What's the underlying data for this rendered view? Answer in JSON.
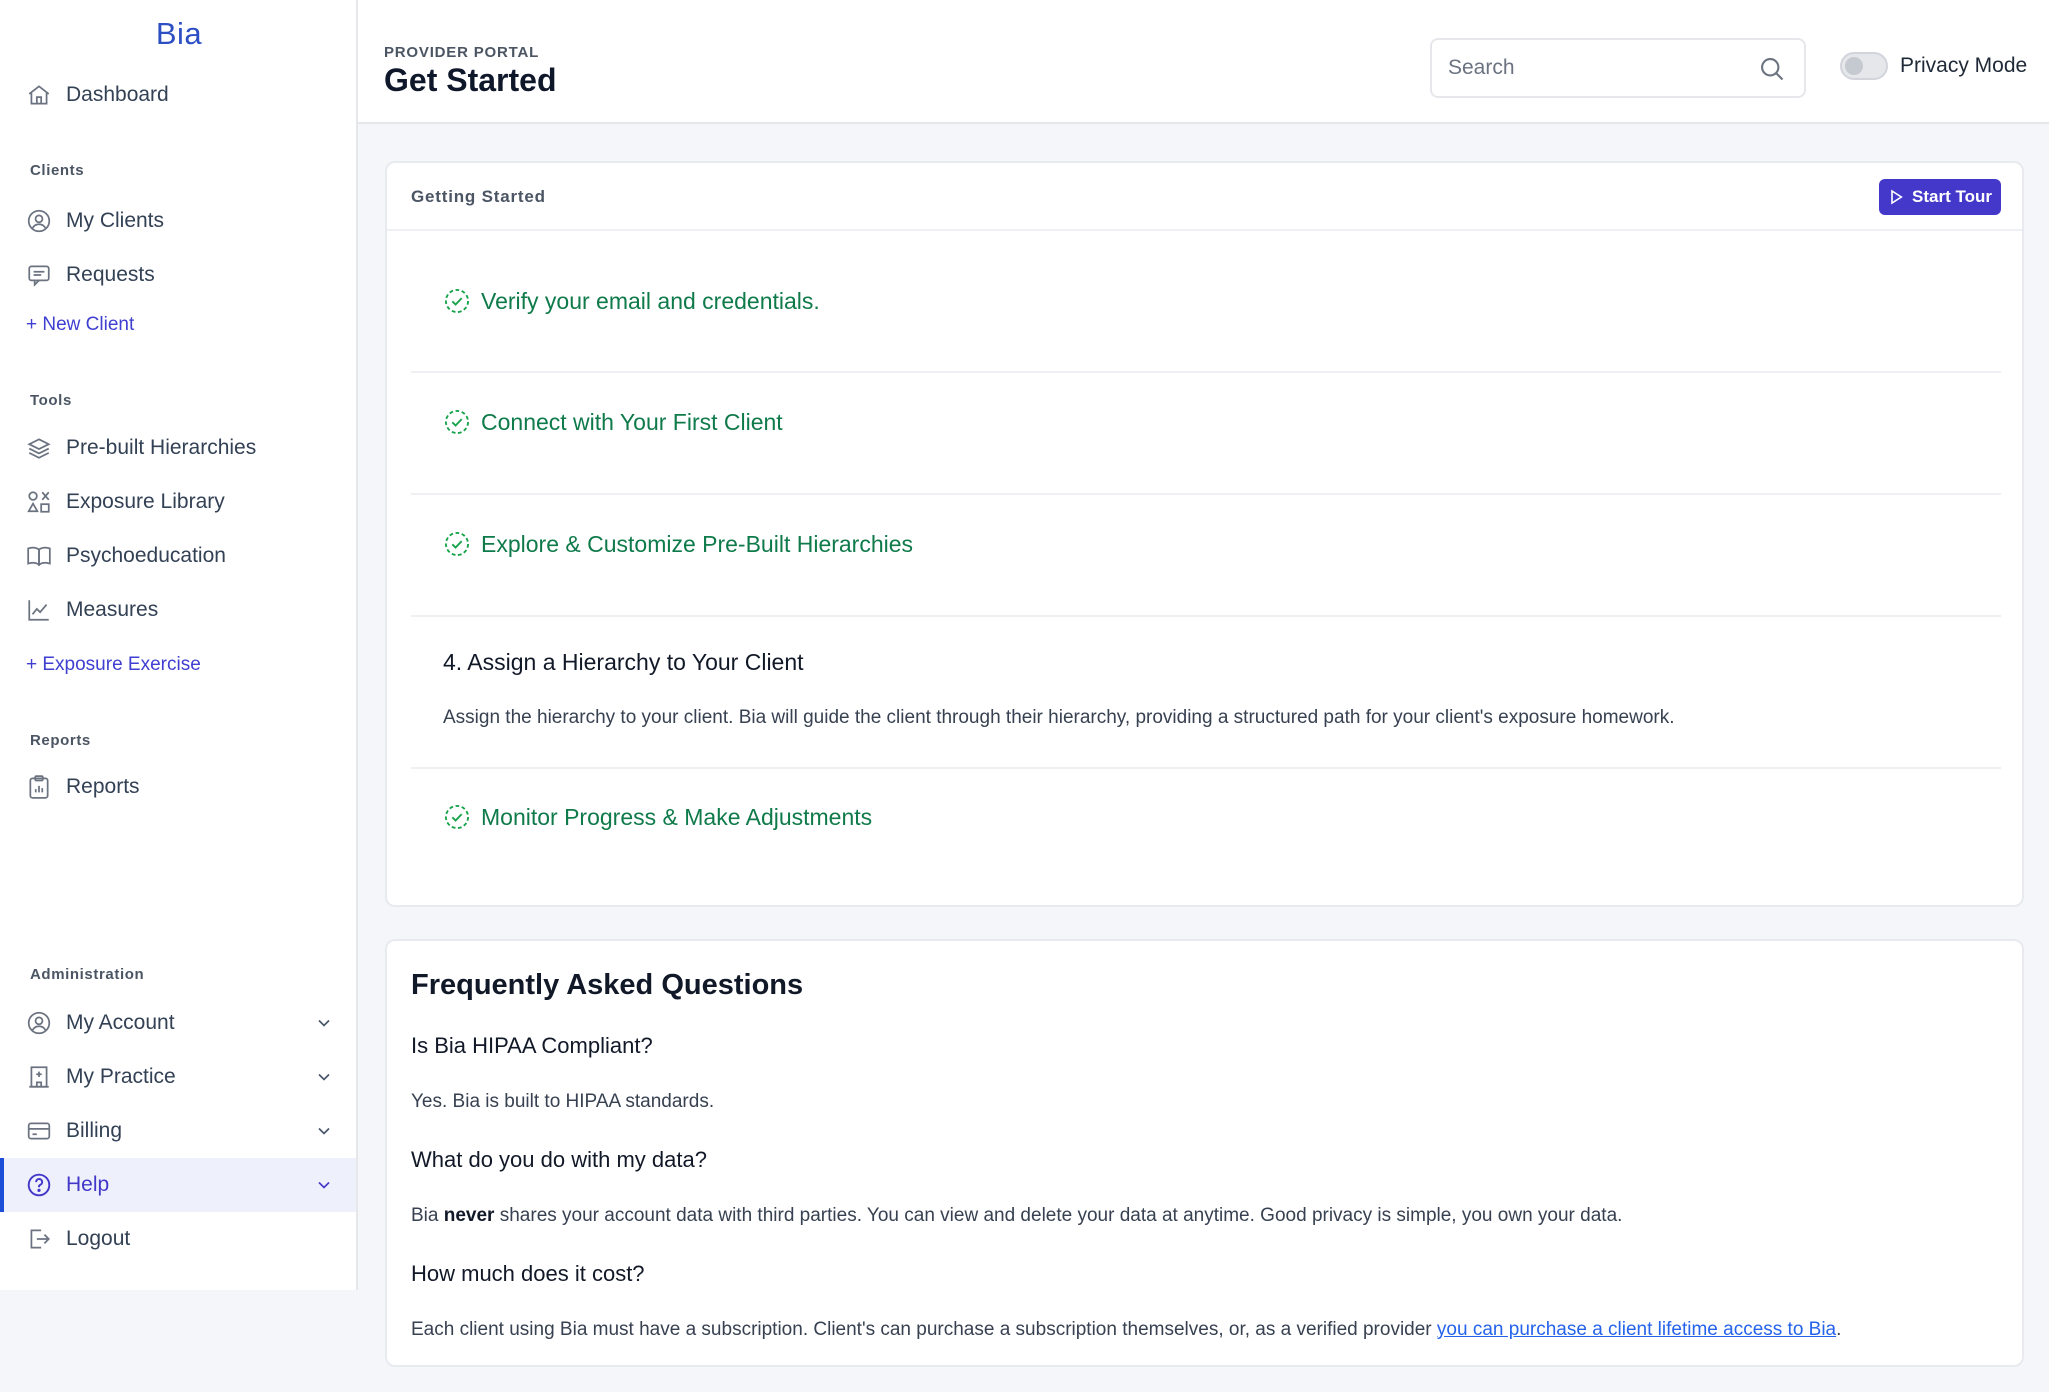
{
  "brand": "Bia",
  "sidebar": {
    "dashboard": "Dashboard",
    "sections": {
      "clients": "Clients",
      "tools": "Tools",
      "reports": "Reports",
      "administration": "Administration"
    },
    "items": {
      "my_clients": "My Clients",
      "requests": "Requests",
      "new_client": "+ New Client",
      "prebuilt": "Pre-built Hierarchies",
      "exposure_library": "Exposure Library",
      "psychoeducation": "Psychoeducation",
      "measures": "Measures",
      "exposure_exercise": "+ Exposure Exercise",
      "reports": "Reports",
      "my_account": "My Account",
      "my_practice": "My Practice",
      "billing": "Billing",
      "help": "Help",
      "logout": "Logout"
    }
  },
  "header": {
    "portal_label": "PROVIDER PORTAL",
    "page_title": "Get Started",
    "search_placeholder": "Search",
    "privacy_label": "Privacy Mode",
    "privacy_on": false
  },
  "getting_started": {
    "title": "Getting Started",
    "start_tour": "Start Tour",
    "steps": [
      {
        "label": "Verify your email and credentials.",
        "done": true
      },
      {
        "label": "Connect with Your First Client",
        "done": true
      },
      {
        "label": "Explore & Customize Pre-Built Hierarchies",
        "done": true
      },
      {
        "label": "4. Assign a Hierarchy to Your Client",
        "done": false,
        "description": "Assign the hierarchy to your client. Bia will guide the client through their hierarchy, providing a structured path for your client's exposure homework."
      },
      {
        "label": "Monitor Progress & Make Adjustments",
        "done": true
      }
    ]
  },
  "faq": {
    "title": "Frequently Asked Questions",
    "items": [
      {
        "q": "Is Bia HIPAA Compliant?",
        "a": "Yes. Bia is built to HIPAA standards."
      },
      {
        "q": "What do you do with my data?",
        "a_pre": "Bia ",
        "a_bold": "never",
        "a_post": " shares your account data with third parties. You can view and delete your data at anytime. Good privacy is simple, you own your data."
      },
      {
        "q": "How much does it cost?",
        "a_pre": "Each client using Bia must have a subscription. Client's can purchase a subscription themselves, or, as a verified provider ",
        "a_link": "you can purchase a client lifetime access to Bia",
        "a_post": "."
      }
    ]
  },
  "colors": {
    "accent": "#4338ca",
    "brand": "#2d4fc4",
    "success": "#0f7a4a",
    "link": "#2563eb"
  }
}
